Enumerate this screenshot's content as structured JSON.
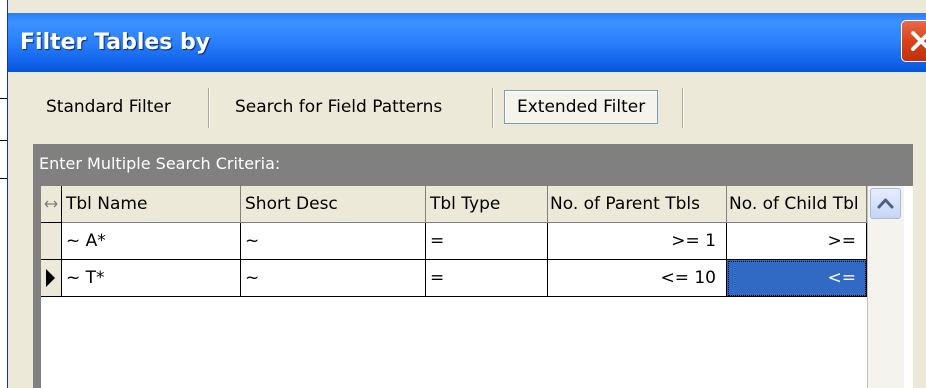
{
  "window": {
    "title": "Filter Tables by"
  },
  "tabs": [
    {
      "label": "Standard Filter",
      "active": false
    },
    {
      "label": "Search for Field Patterns",
      "active": false
    },
    {
      "label": "Extended Filter",
      "active": true
    }
  ],
  "panel": {
    "caption": "Enter Multiple Search Criteria:"
  },
  "grid": {
    "columns": [
      "Tbl Name",
      "Short Desc",
      "Tbl Type",
      "No. of Parent Tbls",
      "No. of Child Tbl"
    ],
    "rows": [
      {
        "current": false,
        "cells": [
          "~ A*",
          "~",
          "=",
          ">= 1",
          ">="
        ]
      },
      {
        "current": true,
        "cells": [
          "~ T*",
          "~",
          "=",
          "<= 10",
          "<="
        ]
      }
    ],
    "selected_cell": {
      "row": 1,
      "column": 4
    }
  },
  "colors": {
    "titlebar": "#0058e6",
    "close_button": "#d9421a",
    "selection": "#316ac5",
    "panel_background": "#808080"
  },
  "icons": {
    "close": "close-x-icon",
    "resize_all": "resize-horizontal-icon",
    "current_row": "row-pointer-icon",
    "scroll_up": "chevron-up-icon"
  }
}
